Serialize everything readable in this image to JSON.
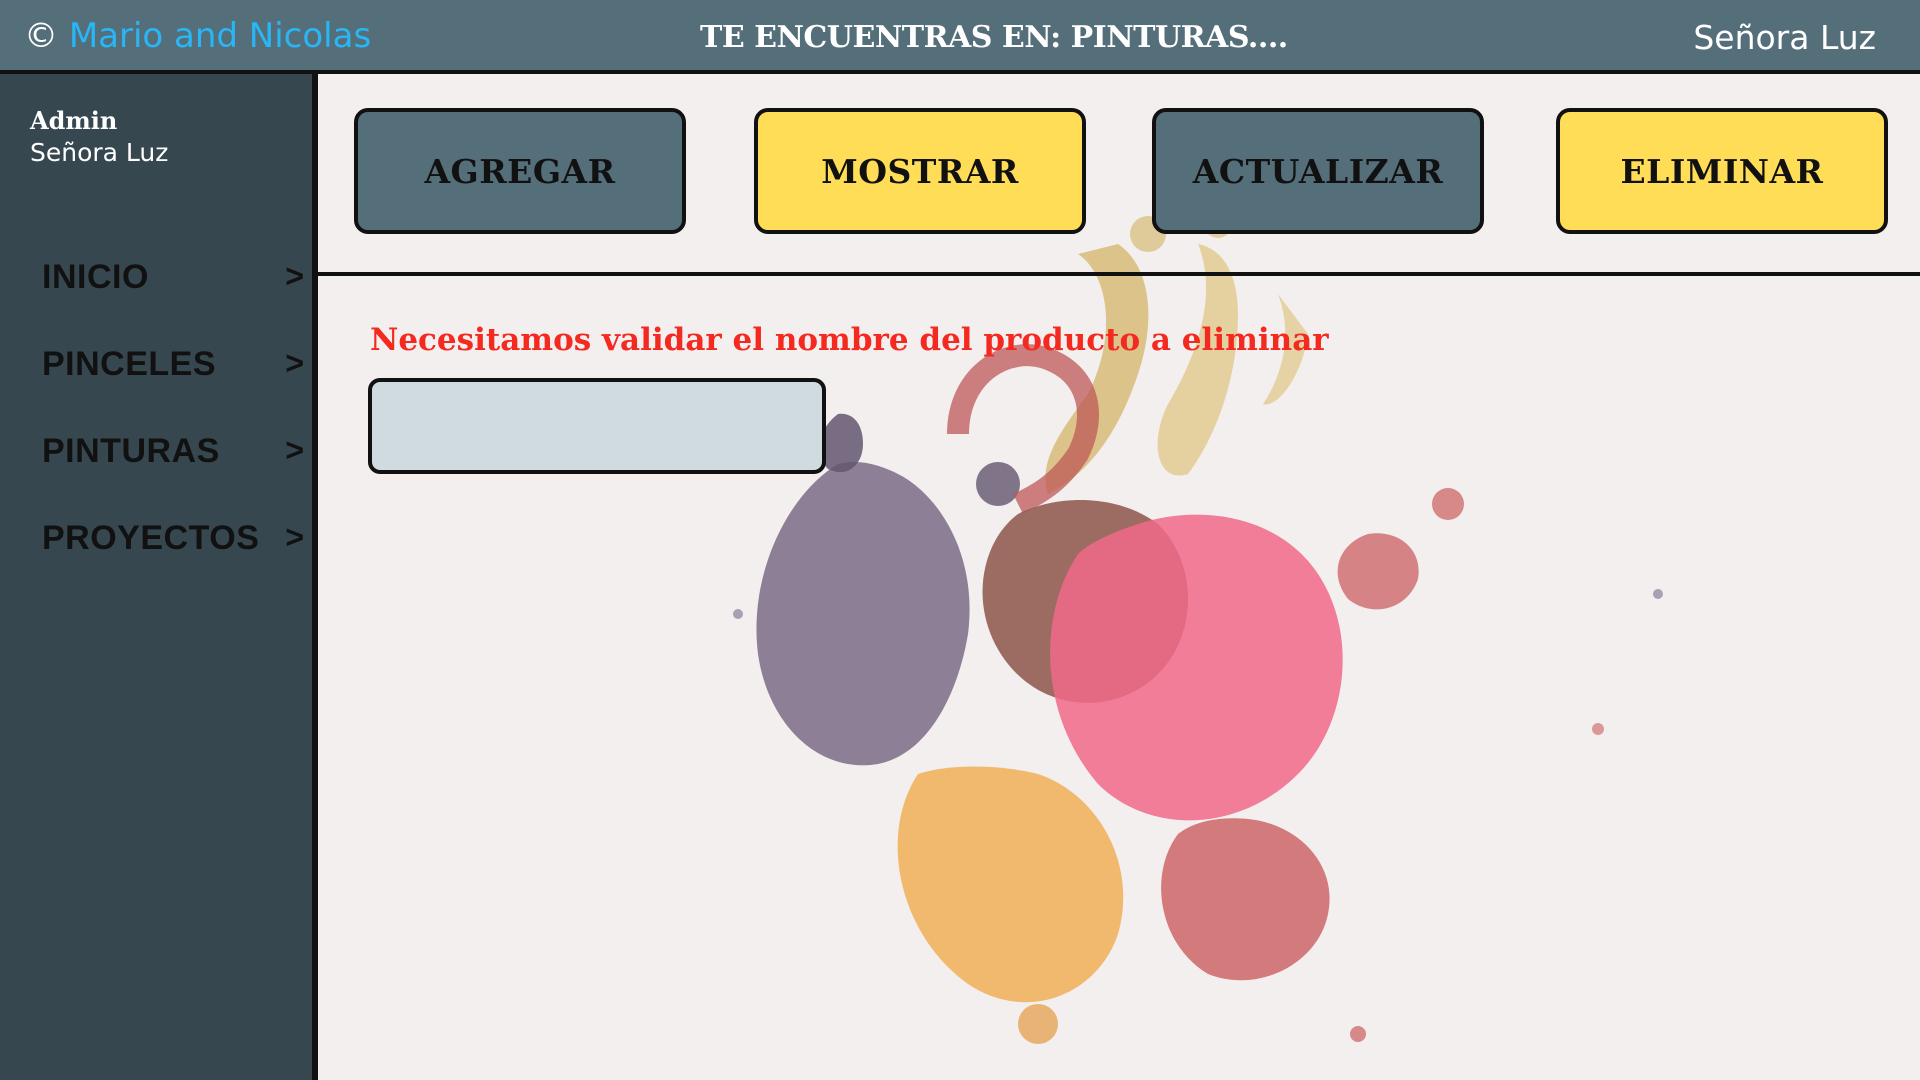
{
  "header": {
    "copyright_symbol": "©",
    "authors": "Mario and Nicolas",
    "location_title": "TE ENCUENTRAS EN: PINTURAS....",
    "user_name": "Señora Luz"
  },
  "sidebar": {
    "role": "Admin",
    "name": "Señora Luz",
    "items": [
      {
        "label": "INICIO",
        "arrow": ">"
      },
      {
        "label": "PINCELES",
        "arrow": ">"
      },
      {
        "label": "PINTURAS",
        "arrow": ">"
      },
      {
        "label": "PROYECTOS",
        "arrow": ">"
      }
    ]
  },
  "actions": {
    "add": "AGREGAR",
    "show": "MOSTRAR",
    "update": "ACTUALIZAR",
    "delete": "ELIMINAR"
  },
  "form": {
    "message": "Necesitamos validar el nombre del producto a eliminar",
    "input_value": "",
    "input_placeholder": ""
  },
  "colors": {
    "topbar": "#546e7a",
    "sidebar": "#37474f",
    "button_slate": "#546e7a",
    "button_yellow": "#ffdd57",
    "message": "#f4291f",
    "authors": "#29b6f6",
    "input_bg": "#cfdbdf"
  }
}
